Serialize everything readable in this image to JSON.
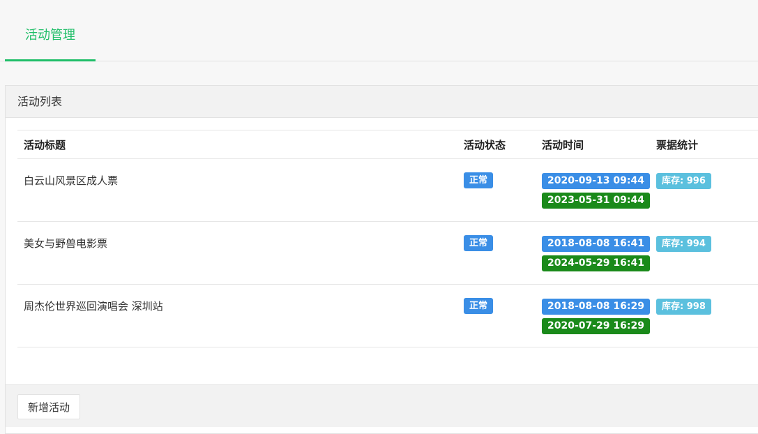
{
  "tabs": [
    {
      "label": "活动管理",
      "active": true
    }
  ],
  "panel": {
    "title": "活动列表",
    "columns": [
      "活动标题",
      "活动状态",
      "活动时间",
      "票据统计"
    ],
    "rows": [
      {
        "title": "白云山风景区成人票",
        "status": "正常",
        "start": "2020-09-13 09:44",
        "end": "2023-05-31 09:44",
        "stock": "库存: 996"
      },
      {
        "title": "美女与野兽电影票",
        "status": "正常",
        "start": "2018-08-08 16:41",
        "end": "2024-05-29 16:41",
        "stock": "库存: 994"
      },
      {
        "title": "周杰伦世界巡回演唱会 深圳站",
        "status": "正常",
        "start": "2018-08-08 16:29",
        "end": "2020-07-29 16:29",
        "stock": "库存: 998"
      }
    ],
    "add_button": "新增活动"
  },
  "colors": {
    "accent": "#1fbe68",
    "status_badge": "#3a8ee6",
    "start_badge": "#3a8ee6",
    "end_badge": "#1a8a1a",
    "stock_badge": "#5bc0de"
  }
}
